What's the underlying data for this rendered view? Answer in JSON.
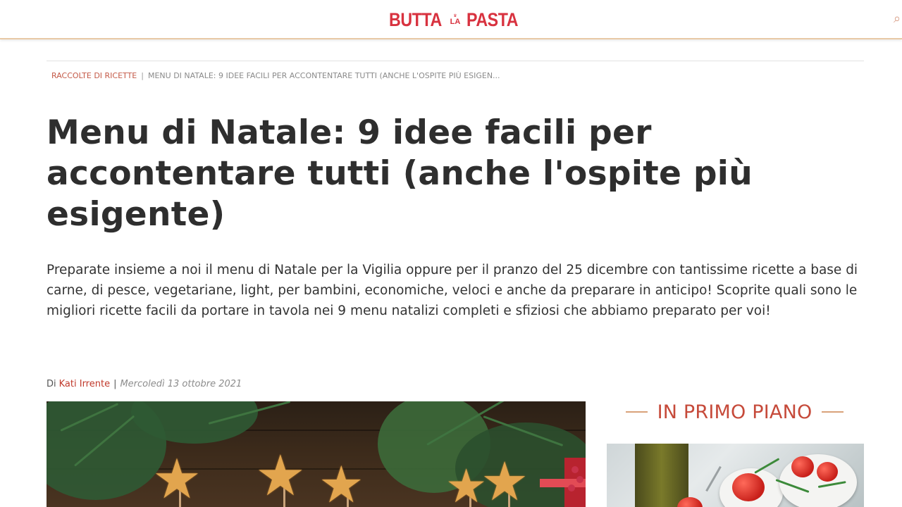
{
  "site": {
    "logo_left": "BUTTA",
    "logo_mid": "LA",
    "logo_right": "PASTA",
    "brand_color": "#d8323f"
  },
  "breadcrumb": {
    "parent": "Raccolte di ricette",
    "separator": "|",
    "current": "Menu di Natale: 9 idee facili per accontentare tutti (anche l'ospite più esigen..."
  },
  "article": {
    "title": "Menu di Natale: 9 idee facili per accontentare tutti (anche l'ospite più esigente)",
    "intro": "Preparate insieme a noi il menu di Natale per la Vigilia oppure per il pranzo del 25 dicembre con tantissime ricette a base di carne, di pesce, vegetariane, light, per bambini, economiche, veloci e anche da preparare in anticipo! Scoprite quali sono le migliori ricette facili da portare in tavola nei 9 menu natalizi completi e sfiziosi che abbiamo preparato per voi!",
    "byline_prefix": "Di",
    "author": "Kati Irrente",
    "byline_separator": "|",
    "date": "Mercoledì 13 ottobre 2021",
    "hero_image_icon": "christmas-star-pastry-image"
  },
  "sidebar": {
    "heading": "IN PRIMO PIANO",
    "featured_image_icon": "tomato-appetizer-image"
  },
  "colors": {
    "accent": "#c64a3a",
    "link": "#c0392b",
    "rule": "#d9a27a",
    "title": "#2e2e2e"
  }
}
